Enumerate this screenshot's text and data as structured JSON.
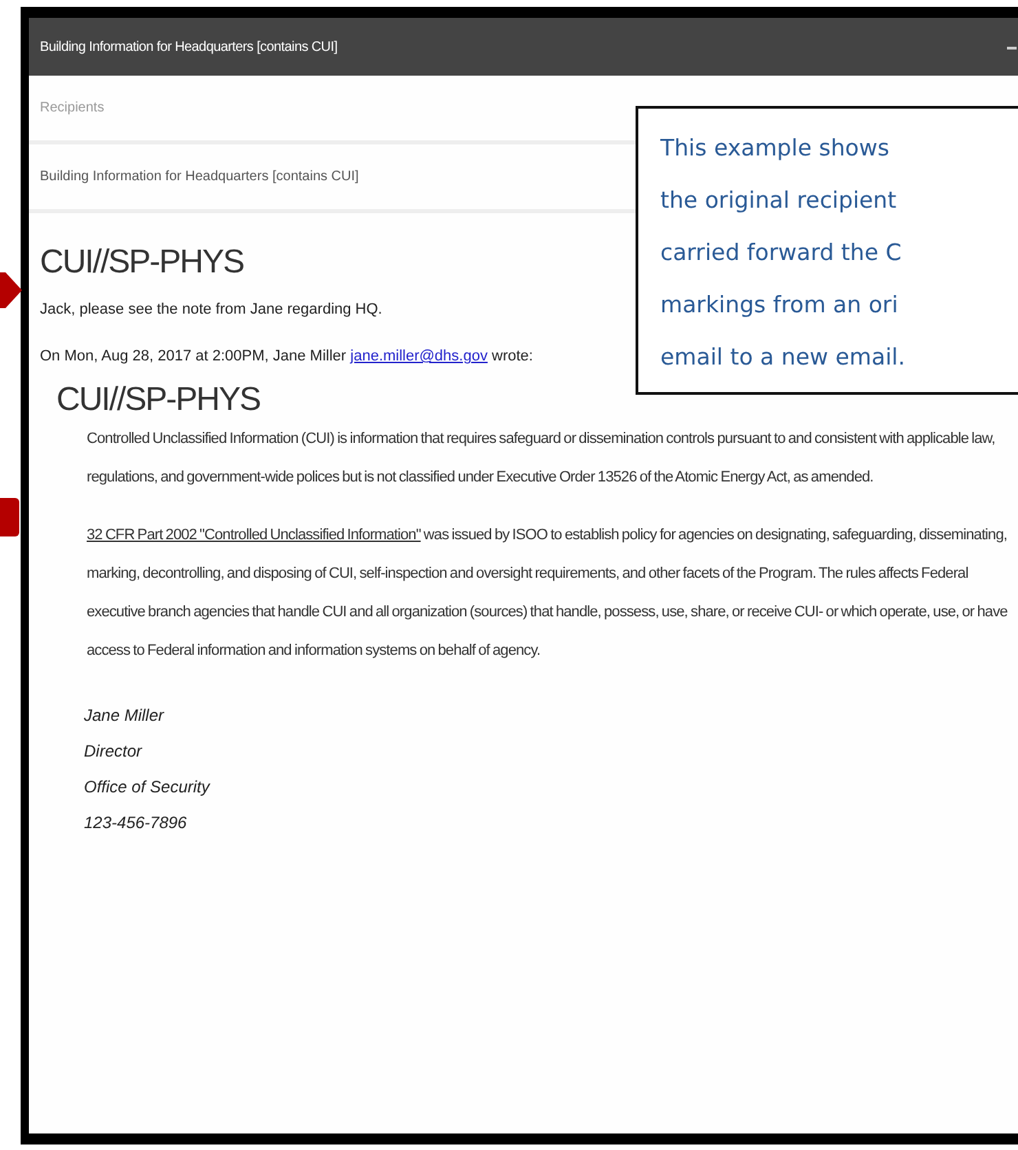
{
  "window": {
    "title": "Building Information for Headquarters [contains CUI]"
  },
  "recipients": {
    "placeholder": "Recipients"
  },
  "subject": {
    "value": "Building Information for Headquarters [contains CUI]"
  },
  "body": {
    "marking": "CUI//SP-PHYS",
    "note": "Jack, please see the note from Jane regarding HQ.",
    "quote_header": {
      "before": "On Mon, Aug 28, 2017 at 2:00PM, Jane Miller ",
      "link": "jane.miller@dhs.gov",
      "after": " wrote:"
    },
    "quoted": {
      "marking": "CUI//SP-PHYS",
      "paragraph_1": "Controlled Unclassified Information (CUI) is information that requires safeguard or dissemination controls pursuant to and consistent with applicable law, regulations, and government-wide polices but is not classified under Executive Order 13526 of the Atomic Energy Act, as amended.",
      "paragraph_2": {
        "link": "32 CFR Part 2002 \"Controlled Unclassified Information\"",
        "text": " was issued by ISOO to establish policy for agencies on designating, safeguarding, disseminating, marking, decontrolling, and disposing of CUI, self-inspection and oversight requirements, and other facets of the Program. The rules affects Federal executive branch agencies that handle CUI and all organization (sources) that handle, possess, use, share, or receive CUI- or which operate, use, or have access to Federal information and information systems on behalf of agency."
      },
      "signature": [
        "Jane Miller",
        "Director",
        "Office of Security",
        "123-456-7896"
      ]
    }
  },
  "callout": {
    "lines": [
      "This example shows",
      "the original recipient",
      "carried forward the C",
      "markings from an ori",
      "email to a new email."
    ]
  }
}
